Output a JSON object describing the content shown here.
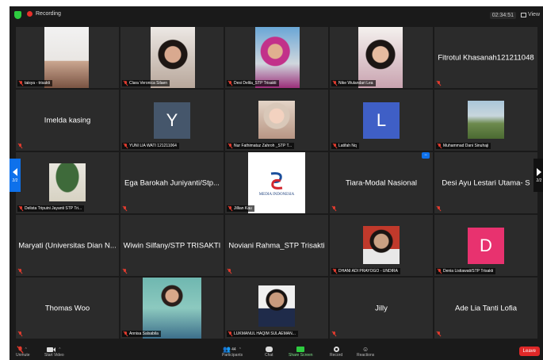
{
  "header": {
    "recording": "Recording",
    "timer": "02:34:51",
    "view": "View"
  },
  "nav": {
    "left_page": "2/2",
    "right_page": "2/2"
  },
  "tiles": [
    {
      "label": "taisya - trisakti"
    },
    {
      "label": "Clara Veronica Silaen"
    },
    {
      "label": "Desi Delila_STP Trisakti"
    },
    {
      "label": "Nike Wulandari Lea"
    },
    {
      "name": "Fitrotul Khasanah121211048"
    },
    {
      "name": "Imelda kasing"
    },
    {
      "label": "YUNI LIA WATI 121211064",
      "avatar": "Y",
      "color": "#45566b"
    },
    {
      "label": "Nur Fathimatuz Zahroh _STP T..."
    },
    {
      "label": "Latifah Nq",
      "avatar": "L",
      "color": "#3f5fc6"
    },
    {
      "label": "Muhammad Dani Sinuhaji"
    },
    {
      "label": "Delista Tripuini Jayanti STP Tri..."
    },
    {
      "name": "Ega Barokah Juniyanti/Stp..."
    },
    {
      "label": "Jillian Kau",
      "logo_text": "MEDIA INDONESIA"
    },
    {
      "name": "Tiara-Modal Nasional"
    },
    {
      "name": "Desi Ayu Lestari Utama- S"
    },
    {
      "name": "Maryati (Universitas Dian N..."
    },
    {
      "name": "Wiwin Silfany/STP TRISAKTI"
    },
    {
      "name": "Noviani Rahma_STP Trisakti"
    },
    {
      "label": "DHANI ADI PRAYOGO - UNDIRA"
    },
    {
      "label": "Denia Listiawati/STP Trisakti",
      "avatar": "D",
      "color": "#e8326f"
    },
    {
      "name": "Thomas Woo"
    },
    {
      "label": "Annisa Salsabila"
    },
    {
      "label": "LUKMANUL HAQIM SULAEMAN..."
    },
    {
      "name": "Jilly"
    },
    {
      "name": "Ade Lia Tanti Lofia"
    }
  ],
  "toolbar": {
    "unmute": "Unmute",
    "start_video": "Start Video",
    "participants": "Participants",
    "participant_count": "44",
    "chat": "Chat",
    "share_screen": "Share Screen",
    "record": "Record",
    "reactions": "Reactions",
    "leave": "Leave"
  }
}
